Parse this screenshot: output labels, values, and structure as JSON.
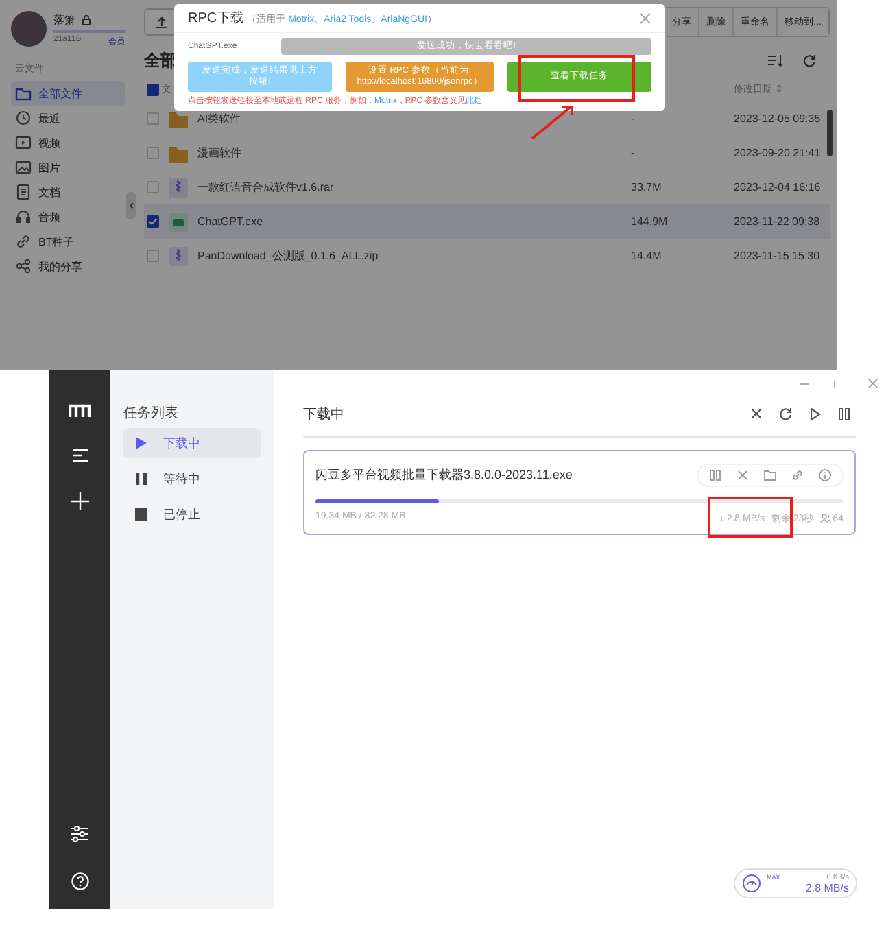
{
  "cloud_drive": {
    "user": {
      "name": "落箫",
      "subtitle": "21a11B",
      "badge": "会员"
    },
    "section_label": "云文件",
    "sidebar": [
      {
        "label": "全部文件",
        "selected": true
      },
      {
        "label": "最近",
        "selected": false
      },
      {
        "label": "视频",
        "selected": false
      },
      {
        "label": "图片",
        "selected": false
      },
      {
        "label": "文档",
        "selected": false
      },
      {
        "label": "音频",
        "selected": false
      },
      {
        "label": "BT种子",
        "selected": false
      },
      {
        "label": "我的分享",
        "selected": false
      }
    ],
    "toolbar": [
      "分享",
      "删除",
      "重命名",
      "移动到..."
    ],
    "heading": "全部",
    "column_1": "文",
    "date_column": "修改日期 ⇕",
    "select_all_partial": true,
    "rows": [
      {
        "name": "AI类软件",
        "kind": "folder",
        "size": "-",
        "modified": "2023-12-05 09:35",
        "checked": false
      },
      {
        "name": "漫画软件",
        "kind": "folder",
        "size": "-",
        "modified": "2023-09-20 21:41",
        "checked": false
      },
      {
        "name": "一款红语音合成软件v1.6.rar",
        "kind": "archive",
        "size": "33.7M",
        "modified": "2023-12-04 16:16",
        "checked": false
      },
      {
        "name": "ChatGPT.exe",
        "kind": "app",
        "size": "144.9M",
        "modified": "2023-11-22 09:38",
        "checked": true
      },
      {
        "name": "PanDownload_公测版_0.1.6_ALL.zip",
        "kind": "archive",
        "size": "14.4M",
        "modified": "2023-11-15 15:30",
        "checked": false
      }
    ]
  },
  "rpc_dialog": {
    "title": "RPC下载",
    "supports": [
      {
        "text": "（适用于 ",
        "link": false
      },
      {
        "text": "Motrix",
        "link": true
      },
      {
        "text": "、",
        "link": false
      },
      {
        "text": "Aria2 Tools",
        "link": true
      },
      {
        "text": "、",
        "link": false
      },
      {
        "text": "AriaNgGUI",
        "link": true
      },
      {
        "text": "）",
        "link": false
      }
    ],
    "file": "ChatGPT.exe",
    "status": "发送成功，快去看看吧!",
    "buttons": [
      {
        "label": "发送完成，发送结果见上方按钮!",
        "kind": "info"
      },
      {
        "label": "设置 RPC 参数（当前为: http://localhost:16800/jsonrpc）",
        "kind": "warning"
      },
      {
        "label": "查看下载任务",
        "kind": "success"
      }
    ],
    "note": [
      {
        "text": "点击按钮发送链接至本地或远程 RPC 服务，例如：",
        "link": false
      },
      {
        "text": "Motrix",
        "link": true
      },
      {
        "text": "，RPC 参数含义见",
        "link": false
      },
      {
        "text": "此处",
        "link": true
      }
    ]
  },
  "motrix": {
    "nav_title": "任务列表",
    "nav": [
      {
        "label": "下载中",
        "selected": true
      },
      {
        "label": "等待中",
        "selected": false
      },
      {
        "label": "已停止",
        "selected": false
      }
    ],
    "heading": "下载中",
    "tasks": [
      {
        "name": "闪豆多平台视频批量下载器3.8.0.0-2023.11.exe",
        "level": 0.235,
        "progress": "19.34 MB / 82.28 MB",
        "speed": "↓ 2.8 MB/s",
        "remaining": "剩余 23秒",
        "connections": "64"
      }
    ],
    "speedometer": {
      "label": "MAX",
      "upload": "0 KB/s",
      "download": "2.8 MB/s"
    }
  }
}
